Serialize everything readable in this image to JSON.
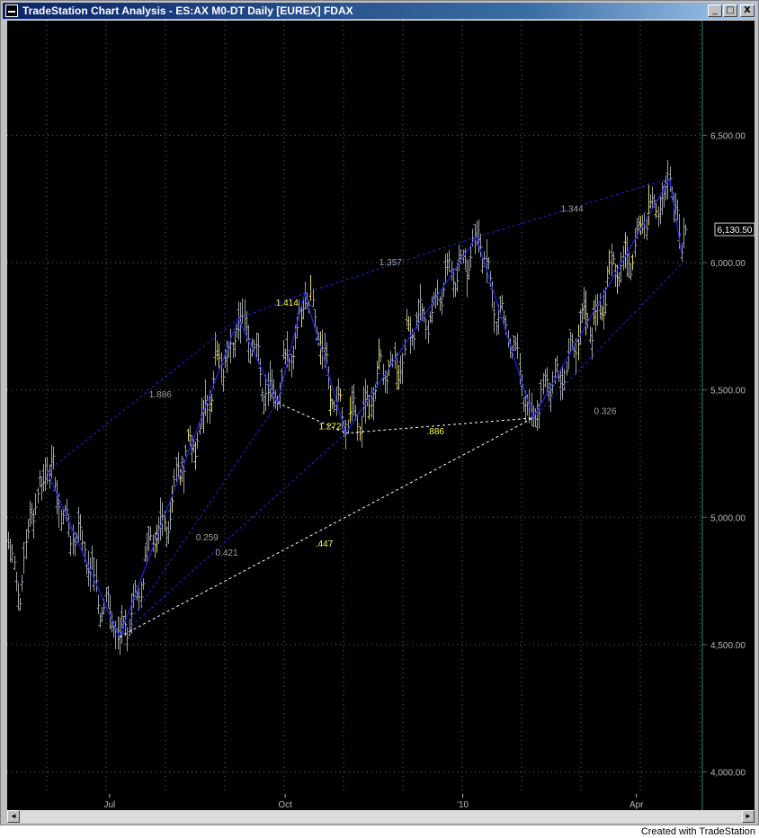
{
  "window": {
    "title": "TradeStation Chart Analysis - ES:AX M0-DT  Daily  [EUREX] FDAX",
    "minimize_label": "_",
    "maximize_label": "□",
    "close_label": "X"
  },
  "scrollbar": {
    "left_label": "◄",
    "right_label": "►"
  },
  "credit": "Created with TradeStation",
  "colors": {
    "background": "#000000",
    "grid": "#3c7a6e",
    "bar_normal": "#9aa0a6",
    "bar_highlight": "#e8d84a",
    "pattern": "#2222ee",
    "ratio_yellow": "#ffff40",
    "ratio_gray": "#a0a0a0",
    "axis_text": "#b8b8b8"
  },
  "chart_data": {
    "type": "ohlc",
    "ylim": [
      3850,
      6950
    ],
    "grid": true,
    "y_ticks": [
      "4,000.00",
      "4,500.00",
      "5,000.00",
      "5,500.00",
      "6,000.00",
      "6,500.00"
    ],
    "y_tick_values": [
      4000,
      4500,
      5000,
      5500,
      6000,
      6500
    ],
    "x_ticks": [
      "Jul",
      "Oct",
      "'10",
      "Apr"
    ],
    "last_price": "6,130.50",
    "last_price_value": 6130.5,
    "pivots": [
      {
        "day": 20,
        "price": 5180
      },
      {
        "day": 57,
        "price": 4530
      },
      {
        "day": 118,
        "price": 5780
      },
      {
        "day": 138,
        "price": 5450
      },
      {
        "day": 152,
        "price": 5880
      },
      {
        "day": 173,
        "price": 5330
      },
      {
        "day": 240,
        "price": 6100
      },
      {
        "day": 269,
        "price": 5390
      },
      {
        "day": 339,
        "price": 6330
      },
      {
        "day": 345,
        "price": 6040
      }
    ],
    "ratios": [
      {
        "text": "1.886",
        "color": "gray",
        "day": 78,
        "price": 5470
      },
      {
        "text": "1.414",
        "color": "yellow",
        "day": 143,
        "price": 5830
      },
      {
        "text": "1.272",
        "color": "yellow",
        "day": 165,
        "price": 5345
      },
      {
        "text": "1.357",
        "color": "gray",
        "day": 196,
        "price": 5990
      },
      {
        "text": ".886",
        "color": "yellow",
        "day": 219,
        "price": 5325
      },
      {
        "text": "1.344",
        "color": "gray",
        "day": 289,
        "price": 6200
      },
      {
        "text": "0.326",
        "color": "gray",
        "day": 306,
        "price": 5405
      },
      {
        "text": "0.259",
        "color": "gray",
        "day": 102,
        "price": 4910
      },
      {
        "text": "0.421",
        "color": "gray",
        "day": 112,
        "price": 4850
      },
      {
        "text": ".447",
        "color": "yellow",
        "day": 162,
        "price": 4885
      }
    ]
  }
}
